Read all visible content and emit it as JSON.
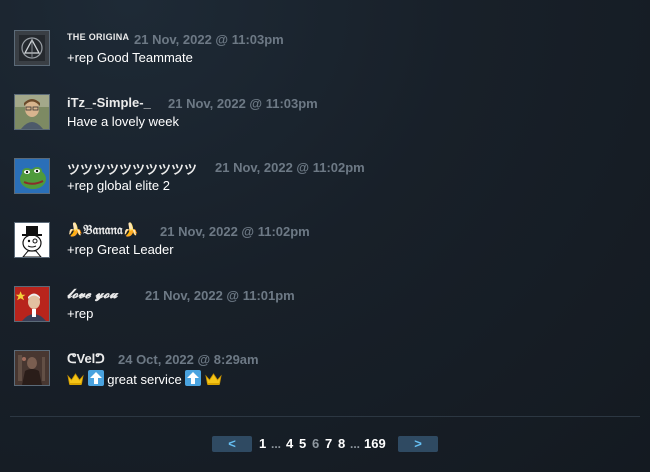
{
  "comments": [
    {
      "author": "THE ORIGINA",
      "timestamp": "21 Nov, 2022 @ 11:03pm",
      "text": "+rep Good Teammate",
      "avatar_icon": "triangle-logo-avatar"
    },
    {
      "author": "iTz_-Simple-_",
      "timestamp": "21 Nov, 2022 @ 11:03pm",
      "text": "Have a lovely week",
      "avatar_icon": "man-portrait-avatar"
    },
    {
      "author": "ツツツツツツツツツツ",
      "timestamp": "21 Nov, 2022 @ 11:02pm",
      "text": "+rep global elite 2",
      "avatar_icon": "pepe-frog-avatar"
    },
    {
      "author": "🍌𝔅𝔞𝔫𝔞𝔫𝔞🍌",
      "timestamp": "21 Nov, 2022 @ 11:02pm",
      "text": "+rep Great Leader",
      "avatar_icon": "top-hat-meme-avatar"
    },
    {
      "author": "𝓵𝓸𝓿𝓮 𝔂𝓸𝓾",
      "timestamp": "21 Nov, 2022 @ 11:01pm",
      "text": "+rep",
      "avatar_icon": "red-flag-portrait-avatar"
    },
    {
      "author": "ᕦVelᕤ",
      "timestamp": "24 Oct, 2022 @ 8:29am",
      "text": "great service",
      "avatar_icon": "dark-figure-avatar"
    }
  ],
  "pagination": {
    "prev_label": "<",
    "next_label": ">",
    "pages": [
      "1",
      "4",
      "5",
      "6",
      "7",
      "8",
      "169"
    ],
    "ellipsis": "...",
    "current_page": "6"
  },
  "colors": {
    "background": "#182029",
    "author": "#ebebeb",
    "timestamp": "#6d7985",
    "text": "#ffffff",
    "pager_button": "#2f4a62",
    "pager_arrow": "#66c0f4"
  }
}
